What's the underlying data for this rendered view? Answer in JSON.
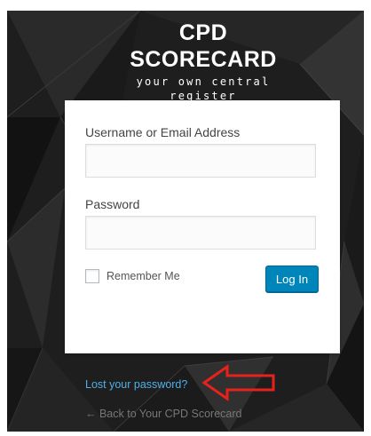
{
  "branding": {
    "title": "CPD SCORECARD",
    "tagline": "your own central register"
  },
  "login_form": {
    "username_label": "Username or Email Address",
    "username_value": "",
    "password_label": "Password",
    "password_value": "",
    "remember_label": "Remember Me",
    "remember_checked": false,
    "submit_label": "Log In"
  },
  "links": {
    "lost_password": "Lost your password?",
    "back_to_site": "← Back to Your CPD Scorecard"
  },
  "annotation": {
    "arrow_icon": "red-left-arrow-icon",
    "arrow_color": "#e8211c"
  },
  "colors": {
    "primary_button": "#0085ba",
    "link": "#4fb0e8",
    "background": "#1c1c1c"
  }
}
